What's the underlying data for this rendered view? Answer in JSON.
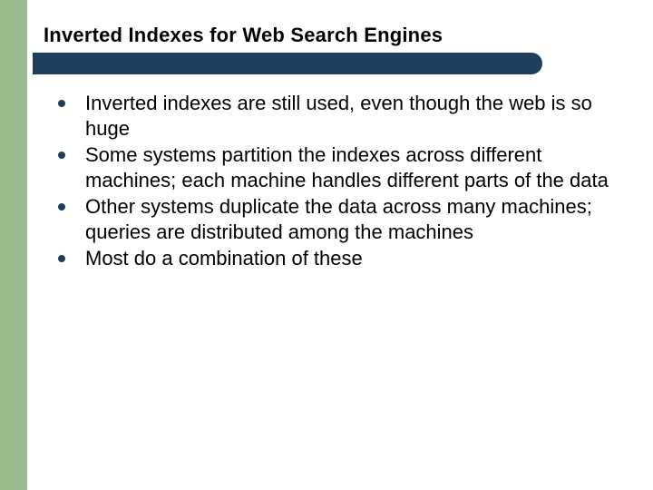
{
  "slide": {
    "title": "Inverted Indexes for Web Search Engines",
    "bullets": [
      "Inverted indexes are still used, even though the web is so huge",
      "Some systems partition the indexes across different machines; each machine handles different parts of the data",
      "Other systems duplicate the data across many machines; queries are distributed among the machines",
      "Most do a combination of these"
    ]
  }
}
